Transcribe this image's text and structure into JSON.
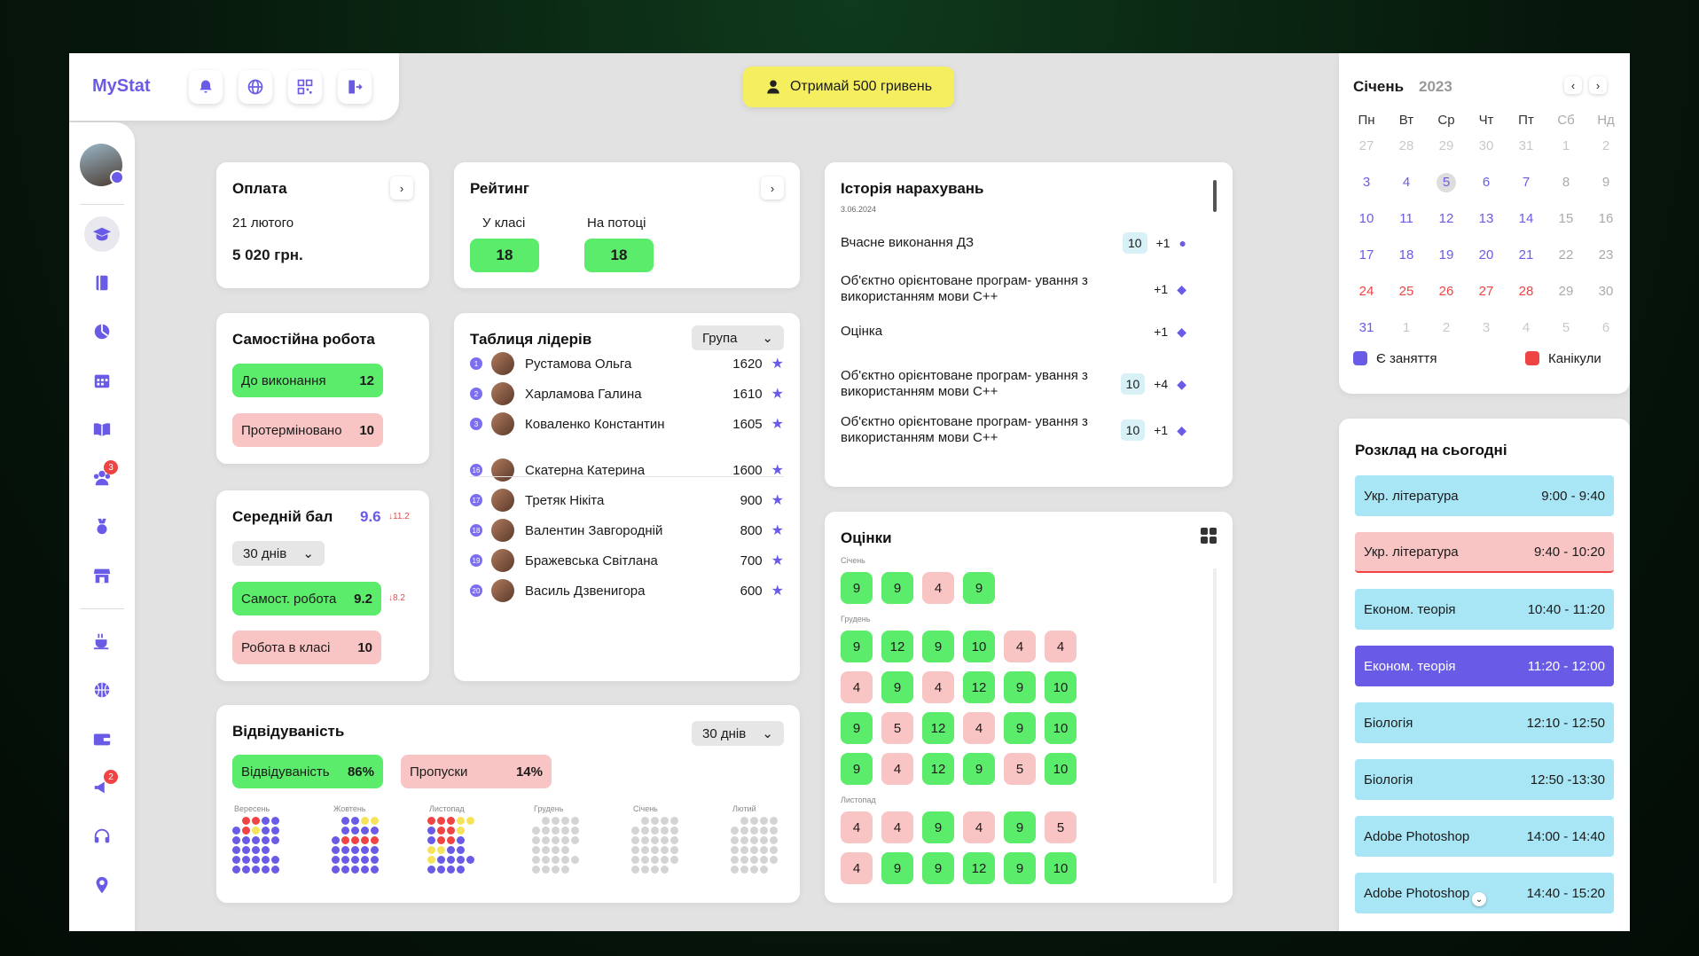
{
  "app": {
    "name": "MyStat"
  },
  "promo": {
    "label": "Отримай 500 гривень"
  },
  "payment": {
    "title": "Оплата",
    "date": "21 лютого",
    "amount": "5 020 грн."
  },
  "rating": {
    "title": "Рейтинг",
    "class_label": "У класі",
    "class_value": "18",
    "stream_label": "На потоці",
    "stream_value": "18"
  },
  "selfwork": {
    "title": "Самостійна робота",
    "todo_label": "До виконання",
    "todo_value": "12",
    "overdue_label": "Протерміновано",
    "overdue_value": "10"
  },
  "avg": {
    "title": "Середній бал",
    "value": "9.6",
    "delta": "↓11.2",
    "period": "30 днів",
    "self_label": "Самост. робота",
    "self_value": "9.2",
    "self_delta": "↓8.2",
    "class_label": "Робота в класі",
    "class_value": "10"
  },
  "leaders": {
    "title": "Таблиця лідерів",
    "filter": "Група",
    "rows": [
      {
        "rank": "1",
        "name": "Рустамова Ольга",
        "score": "1620"
      },
      {
        "rank": "2",
        "name": "Харламова Галина",
        "score": "1610"
      },
      {
        "rank": "3",
        "name": "Коваленко Константин",
        "score": "1605"
      },
      {
        "rank": "16",
        "name": "Скатерна Катерина",
        "score": "1600"
      },
      {
        "rank": "17",
        "name": "Третяк Нікіта",
        "score": "900"
      },
      {
        "rank": "18",
        "name": "Валентин Завгородній",
        "score": "800"
      },
      {
        "rank": "19",
        "name": "Бражевська Світлана",
        "score": "700"
      },
      {
        "rank": "20",
        "name": "Василь Дзвенигора",
        "score": "600"
      }
    ]
  },
  "history": {
    "title": "Історія нарахувань",
    "date": "3.06.2024",
    "rows": [
      {
        "text": "Вчасне виконання ДЗ",
        "grade": "10",
        "points": "+1"
      },
      {
        "text": "Об'єктно орієнтоване програм- ування з використанням мови C++",
        "grade": "",
        "points": "+1"
      },
      {
        "text": "Оцінка",
        "grade": "",
        "points": "+1"
      },
      {
        "text": "Об'єктно орієнтоване програм- ування з використанням мови C++",
        "grade": "10",
        "points": "+4"
      },
      {
        "text": "Об'єктно орієнтоване програм- ування з використанням мови C++",
        "grade": "10",
        "points": "+1"
      }
    ]
  },
  "attendance": {
    "title": "Відвідуваність",
    "period": "30 днів",
    "att_label": "Відвідуваність",
    "att_value": "86%",
    "miss_label": "Пропуски",
    "miss_value": "14%",
    "months": [
      "Вересень",
      "Жовтень",
      "Листопад",
      "Грудень",
      "Січень",
      "Лютий"
    ]
  },
  "grades": {
    "title": "Оцінки",
    "months": [
      {
        "name": "Січень",
        "rows": [
          [
            "9",
            "9",
            "4",
            "9"
          ]
        ]
      },
      {
        "name": "Грудень",
        "rows": [
          [
            "9",
            "12",
            "9",
            "10",
            "4",
            "4"
          ],
          [
            "4",
            "9",
            "4",
            "12",
            "9",
            "10"
          ],
          [
            "9",
            "5",
            "12",
            "4",
            "9",
            "10"
          ],
          [
            "9",
            "4",
            "12",
            "9",
            "5",
            "10"
          ]
        ]
      },
      {
        "name": "Листопад",
        "rows": [
          [
            "4",
            "4",
            "9",
            "4",
            "9",
            "5"
          ],
          [
            "4",
            "9",
            "9",
            "12",
            "9",
            "10"
          ]
        ]
      }
    ]
  },
  "calendar": {
    "month": "Січень",
    "year": "2023",
    "weekdays": [
      "Пн",
      "Вт",
      "Ср",
      "Чт",
      "Пт",
      "Сб",
      "Нд"
    ],
    "weeks": [
      [
        "27",
        "28",
        "29",
        "30",
        "31",
        "1",
        "2"
      ],
      [
        "3",
        "4",
        "5",
        "6",
        "7",
        "8",
        "9"
      ],
      [
        "10",
        "11",
        "12",
        "13",
        "14",
        "15",
        "16"
      ],
      [
        "17",
        "18",
        "19",
        "20",
        "21",
        "22",
        "23"
      ],
      [
        "24",
        "25",
        "26",
        "27",
        "28",
        "29",
        "30"
      ],
      [
        "31",
        "1",
        "2",
        "3",
        "4",
        "5",
        "6"
      ]
    ],
    "legend_class": "Є заняття",
    "legend_holiday": "Канікули",
    "today": "5"
  },
  "schedule": {
    "title": "Розклад на сьогодні",
    "items": [
      {
        "name": "Укр. література",
        "time": "9:00 - 9:40"
      },
      {
        "name": "Укр. література",
        "time": "9:40 - 10:20"
      },
      {
        "name": "Економ. теорія",
        "time": "10:40 - 11:20"
      },
      {
        "name": "Економ. теорія",
        "time": "11:20 - 12:00"
      },
      {
        "name": "Біологія",
        "time": "12:10 - 12:50"
      },
      {
        "name": "Біологія",
        "time": "12:50 -13:30"
      },
      {
        "name": "Adobe Photoshop",
        "time": "14:00 - 14:40"
      },
      {
        "name": "Adobe Photoshop",
        "time": "14:40 - 15:20"
      }
    ]
  },
  "sidebar": {
    "badges": {
      "group": "3",
      "news": "2"
    }
  },
  "colors": {
    "accent": "#6a5be6",
    "green": "#5cec6c",
    "pink": "#f8c4c4",
    "cyan": "#a8e6f6"
  }
}
